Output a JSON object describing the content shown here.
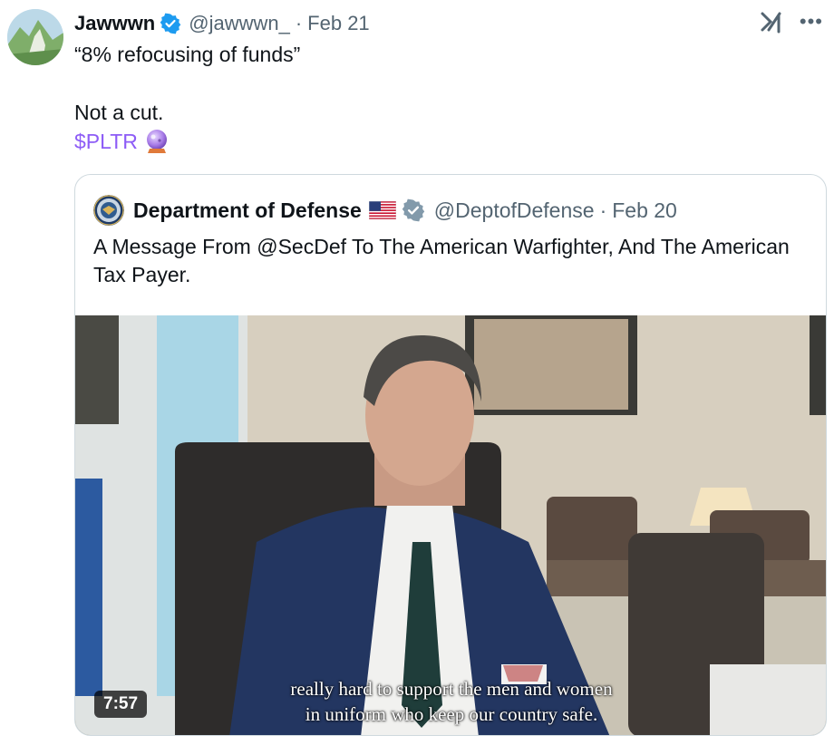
{
  "tweet": {
    "author_name": "Jawwwn",
    "handle": "@jawwwn_",
    "separator": "·",
    "date": "Feb 21",
    "lines": [
      "“8% refocusing of funds”",
      "",
      "Not a cut."
    ],
    "cashtag": "$PLTR",
    "emoji": "crystal-ball-icon"
  },
  "quote": {
    "author_name": "Department of Defense",
    "handle": "@DeptofDefense",
    "separator": "·",
    "date": "Feb 20",
    "text": "A Message From @SecDef To The American Warfighter, And The American Tax Payer.",
    "video": {
      "duration": "7:57",
      "subtitle_lines": [
        "really hard to support the men and women",
        "in uniform who keep our country safe."
      ]
    }
  },
  "colors": {
    "verified_blue": "#1d9bf0",
    "gov_gray": "#829aab",
    "cashtag_purple": "#8d5cf6",
    "secondary_text": "#536471"
  }
}
